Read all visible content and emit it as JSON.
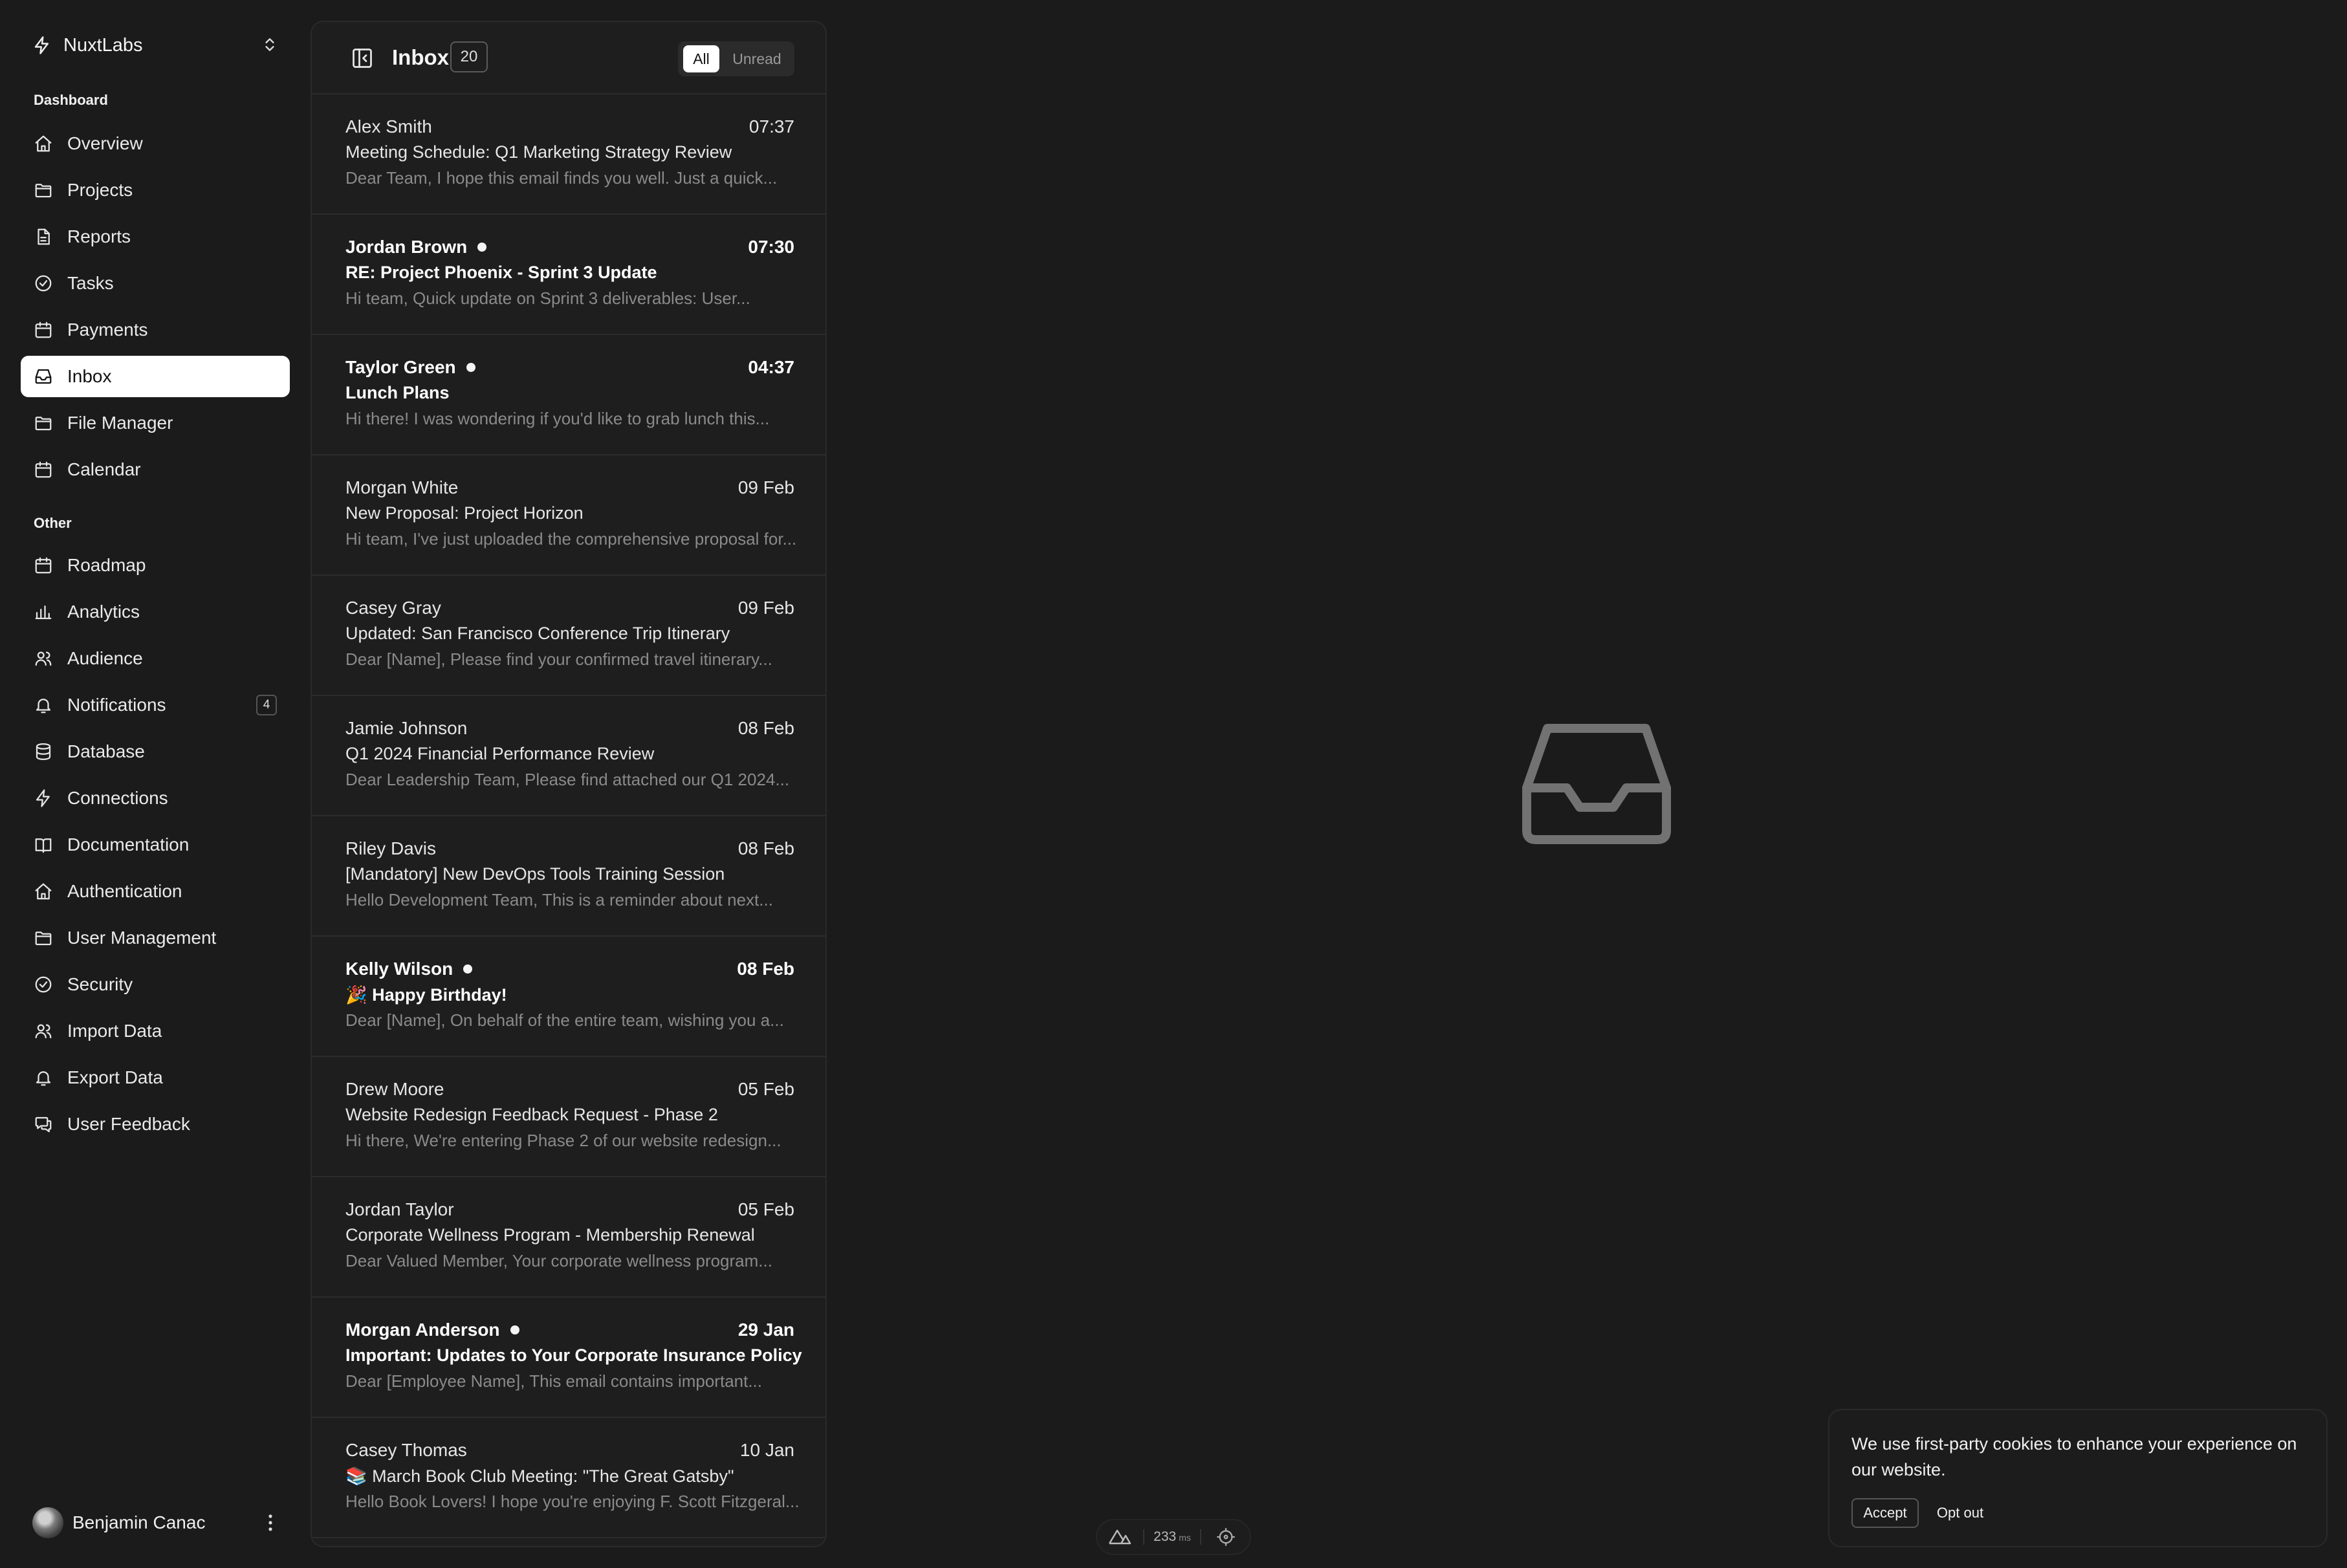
{
  "sidebar": {
    "team": "NuxtLabs",
    "groups": [
      {
        "label": "Dashboard"
      },
      {
        "label": "Other"
      }
    ],
    "items": [
      {
        "label": "Overview",
        "icon": "home-icon"
      },
      {
        "label": "Projects",
        "icon": "folder-icon"
      },
      {
        "label": "Reports",
        "icon": "file-icon"
      },
      {
        "label": "Tasks",
        "icon": "check-circle-icon"
      },
      {
        "label": "Payments",
        "icon": "calendar-icon"
      },
      {
        "label": "Inbox",
        "icon": "inbox-icon"
      },
      {
        "label": "File Manager",
        "icon": "folder-icon"
      },
      {
        "label": "Calendar",
        "icon": "calendar-icon"
      },
      {
        "label": "Roadmap",
        "icon": "calendar-icon"
      },
      {
        "label": "Analytics",
        "icon": "bar-chart-icon"
      },
      {
        "label": "Audience",
        "icon": "users-icon"
      },
      {
        "label": "Notifications",
        "icon": "bell-icon",
        "badge": "4"
      },
      {
        "label": "Database",
        "icon": "database-icon"
      },
      {
        "label": "Connections",
        "icon": "bolt-icon"
      },
      {
        "label": "Documentation",
        "icon": "book-icon"
      },
      {
        "label": "Authentication",
        "icon": "home-icon"
      },
      {
        "label": "User Management",
        "icon": "folder-icon"
      },
      {
        "label": "Security",
        "icon": "check-circle-icon"
      },
      {
        "label": "Import Data",
        "icon": "users-icon"
      },
      {
        "label": "Export Data",
        "icon": "bell-icon"
      },
      {
        "label": "User Feedback",
        "icon": "chat-icon"
      }
    ],
    "active": "Inbox",
    "user": "Benjamin Canac"
  },
  "inbox": {
    "title": "Inbox",
    "count": "20",
    "filters": [
      "All",
      "Unread"
    ],
    "selected_filter": "All",
    "mails": [
      {
        "from": "Alex Smith",
        "date": "07:37",
        "subject": "Meeting Schedule: Q1 Marketing Strategy Review",
        "preview": "Dear Team, I hope this email finds you well. Just a quick...",
        "unread": false
      },
      {
        "from": "Jordan Brown",
        "date": "07:30",
        "subject": "RE: Project Phoenix - Sprint 3 Update",
        "preview": "Hi team, Quick update on Sprint 3 deliverables: User...",
        "unread": true
      },
      {
        "from": "Taylor Green",
        "date": "04:37",
        "subject": "Lunch Plans",
        "preview": "Hi there! I was wondering if you'd like to grab lunch this...",
        "unread": true
      },
      {
        "from": "Morgan White",
        "date": "09 Feb",
        "subject": "New Proposal: Project Horizon",
        "preview": "Hi team, I've just uploaded the comprehensive proposal for...",
        "unread": false
      },
      {
        "from": "Casey Gray",
        "date": "09 Feb",
        "subject": "Updated: San Francisco Conference Trip Itinerary",
        "preview": "Dear [Name], Please find your confirmed travel itinerary...",
        "unread": false
      },
      {
        "from": "Jamie Johnson",
        "date": "08 Feb",
        "subject": "Q1 2024 Financial Performance Review",
        "preview": "Dear Leadership Team, Please find attached our Q1 2024...",
        "unread": false
      },
      {
        "from": "Riley Davis",
        "date": "08 Feb",
        "subject": "[Mandatory] New DevOps Tools Training Session",
        "preview": "Hello Development Team, This is a reminder about next...",
        "unread": false
      },
      {
        "from": "Kelly Wilson",
        "date": "08 Feb",
        "subject": "🎉 Happy Birthday!",
        "preview": "Dear [Name], On behalf of the entire team, wishing you a...",
        "unread": true
      },
      {
        "from": "Drew Moore",
        "date": "05 Feb",
        "subject": "Website Redesign Feedback Request - Phase 2",
        "preview": "Hi there, We're entering Phase 2 of our website redesign...",
        "unread": false
      },
      {
        "from": "Jordan Taylor",
        "date": "05 Feb",
        "subject": "Corporate Wellness Program - Membership Renewal",
        "preview": "Dear Valued Member, Your corporate wellness program...",
        "unread": false
      },
      {
        "from": "Morgan Anderson",
        "date": "29 Jan",
        "subject": "Important: Updates to Your Corporate Insurance Policy",
        "preview": "Dear [Employee Name], This email contains important...",
        "unread": true
      },
      {
        "from": "Casey Thomas",
        "date": "10 Jan",
        "subject": "📚 March Book Club Meeting: \"The Great Gatsby\"",
        "preview": "Hello Book Lovers! I hope you're enjoying F. Scott Fitzgeral...",
        "unread": false
      }
    ]
  },
  "empty_state": {
    "icon": "inbox-icon"
  },
  "devtools": {
    "ms_value": "233",
    "ms_unit": "ms"
  },
  "cookie": {
    "text": "We use first-party cookies to enhance your experience on our website.",
    "accept": "Accept",
    "opt_out": "Opt out"
  }
}
